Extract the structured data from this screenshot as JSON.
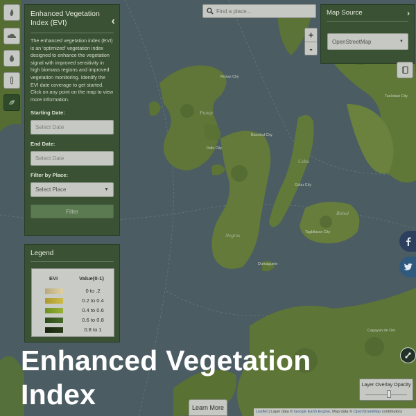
{
  "info_panel": {
    "title": "Enhanced Vegetation Index (EVI)",
    "description": "The enhanced vegetation index (EVI) is an 'optimized' vegetation index designed to enhance the vegetation signal with improved sensitivity in high biomass regions and improved vegetation monitoring. Identify the EVI date coverage to get started. Click on any point on the map to view more information.",
    "starting_date_label": "Starting Date:",
    "starting_date_placeholder": "Select Date",
    "end_date_label": "End Date:",
    "end_date_placeholder": "Select Date",
    "filter_place_label": "Filter by Place:",
    "place_selected": "Select Place",
    "filter_button": "Filter"
  },
  "legend": {
    "title": "Legend",
    "col_evi": "EVI",
    "col_value": "Value(0-1)",
    "rows": [
      {
        "color": "#d8c99a",
        "label": "0 to .2"
      },
      {
        "color": "#c6b440",
        "label": "0.2 to 0.4"
      },
      {
        "color": "#8eaa2e",
        "label": "0.4 to 0.6"
      },
      {
        "color": "#3c5a21",
        "label": "0.6 to 0.8"
      },
      {
        "color": "#1f2d14",
        "label": "0.8 to 1"
      }
    ]
  },
  "search": {
    "placeholder": "Find a place..."
  },
  "map_source": {
    "title": "Map Source",
    "selected": "OpenStreetMap"
  },
  "zoom": {
    "in": "+",
    "out": "-"
  },
  "opacity": {
    "label": "Layer Overlay Opacity",
    "value": 0.5
  },
  "learn_more": "Learn More",
  "attribution": {
    "leaflet": "Leaflet",
    "middle": " | Layer data © ",
    "gee": "Google Earth Engine",
    "middle2": ", Map data © ",
    "osm": "OpenStreetMap",
    "end": " contributors"
  },
  "map_labels": {
    "roxas": "Roxas City",
    "bacolod": "Bacolod City",
    "iloilo": "Iloilo City",
    "cebu": "Cebu City",
    "tagbilaran": "Tagbilaran City",
    "dumaguete": "Dumaguete",
    "tacloban": "Tacloban City",
    "cagayan": "Cagayan de Oro",
    "panay": "Panay",
    "negros": "Negros",
    "cebu_island": "Cebu",
    "bohol": "Bohol"
  },
  "headline": "Enhanced Vegetation Index",
  "colors": {
    "panel": "#3a5134",
    "sea": "#4a5b63",
    "land": "#5f7838"
  }
}
